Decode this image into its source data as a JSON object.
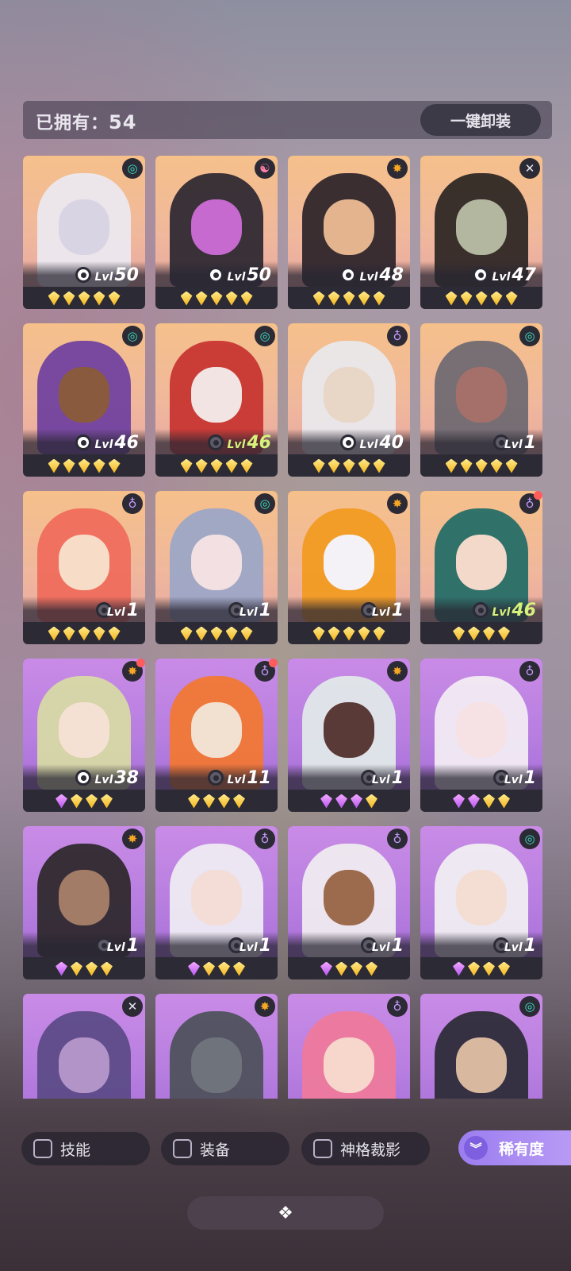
{
  "header": {
    "owned_label": "已拥有：",
    "owned_count": "54",
    "unequip_label": "一键卸装"
  },
  "level_prefix": "Lvl",
  "heroes": [
    {
      "level": "50",
      "bg": "gold",
      "faction": "teal",
      "faction_glyph": "◎",
      "gems": [
        "gold",
        "gold",
        "gold",
        "gold",
        "gold"
      ],
      "skill": true,
      "hl": false,
      "dot": false,
      "fig": "#ece9f2",
      "face": "#d9d4e4"
    },
    {
      "level": "50",
      "bg": "gold",
      "faction": "pink",
      "faction_glyph": "☯",
      "gems": [
        "gold",
        "gold",
        "gold",
        "gold",
        "gold"
      ],
      "skill": true,
      "hl": false,
      "dot": false,
      "fig": "#2a2630",
      "face": "#c66ad0"
    },
    {
      "level": "48",
      "bg": "gold",
      "faction": "orange",
      "faction_glyph": "✸",
      "gems": [
        "gold",
        "gold",
        "gold",
        "gold",
        "gold"
      ],
      "skill": true,
      "hl": false,
      "dot": false,
      "fig": "#2a2228",
      "face": "#e3b48e"
    },
    {
      "level": "47",
      "bg": "gold",
      "faction": "white",
      "faction_glyph": "✕",
      "gems": [
        "gold",
        "gold",
        "gold",
        "gold",
        "gold"
      ],
      "skill": true,
      "hl": false,
      "dot": false,
      "fig": "#2a2422",
      "face": "#b3b7a0"
    },
    {
      "level": "46",
      "bg": "gold",
      "faction": "teal",
      "faction_glyph": "◎",
      "gems": [
        "gold",
        "gold",
        "gold",
        "gold",
        "gold"
      ],
      "skill": true,
      "hl": false,
      "dot": false,
      "fig": "#6e3fa0",
      "face": "#8a5a3e"
    },
    {
      "level": "46",
      "bg": "gold",
      "faction": "teal",
      "faction_glyph": "◎",
      "gems": [
        "gold",
        "gold",
        "gold",
        "gold",
        "gold"
      ],
      "skill": false,
      "hl": true,
      "dot": false,
      "fig": "#c7322f",
      "face": "#f1e4e2"
    },
    {
      "level": "40",
      "bg": "gold",
      "faction": "violet",
      "faction_glyph": "♁",
      "gems": [
        "gold",
        "gold",
        "gold",
        "gold",
        "gold"
      ],
      "skill": true,
      "hl": false,
      "dot": false,
      "fig": "#e9e9ee",
      "face": "#e8d6c6"
    },
    {
      "level": "1",
      "bg": "gold",
      "faction": "teal",
      "faction_glyph": "◎",
      "gems": [
        "gold",
        "gold",
        "gold",
        "gold",
        "gold"
      ],
      "skill": false,
      "hl": false,
      "dot": false,
      "fig": "#6c6871",
      "face": "#a6706a"
    },
    {
      "level": "1",
      "bg": "gold",
      "faction": "violet",
      "faction_glyph": "♁",
      "gems": [
        "gold",
        "gold",
        "gold",
        "gold",
        "gold"
      ],
      "skill": false,
      "hl": false,
      "dot": false,
      "fig": "#f06a5a",
      "face": "#f7dcc8"
    },
    {
      "level": "1",
      "bg": "gold",
      "faction": "teal",
      "faction_glyph": "◎",
      "gems": [
        "gold",
        "gold",
        "gold",
        "gold",
        "gold"
      ],
      "skill": false,
      "hl": false,
      "dot": false,
      "fig": "#9aa6c8",
      "face": "#f2e0e2"
    },
    {
      "level": "1",
      "bg": "gold",
      "faction": "orange",
      "faction_glyph": "✸",
      "gems": [
        "gold",
        "gold",
        "gold",
        "gold",
        "gold"
      ],
      "skill": false,
      "hl": false,
      "dot": false,
      "fig": "#f29a1e",
      "face": "#f4f2f6"
    },
    {
      "level": "46",
      "bg": "gold",
      "faction": "violet",
      "faction_glyph": "♁",
      "gems": [
        "gold",
        "gold",
        "gold",
        "gold"
      ],
      "skill": false,
      "hl": true,
      "dot": true,
      "fig": "#1f6b66",
      "face": "#f3d9c9"
    },
    {
      "level": "38",
      "bg": "purple",
      "faction": "orange",
      "faction_glyph": "✸",
      "gems": [
        "purple",
        "gold",
        "gold",
        "gold"
      ],
      "skill": true,
      "hl": false,
      "dot": true,
      "fig": "#d8dca4",
      "face": "#f5e1d4"
    },
    {
      "level": "11",
      "bg": "purple",
      "faction": "violet",
      "faction_glyph": "♁",
      "gems": [
        "gold",
        "gold",
        "gold",
        "gold"
      ],
      "skill": false,
      "hl": false,
      "dot": true,
      "fig": "#f3772f",
      "face": "#f2e0d0"
    },
    {
      "level": "1",
      "bg": "purple",
      "faction": "orange",
      "faction_glyph": "✸",
      "gems": [
        "purple",
        "purple",
        "purple",
        "gold"
      ],
      "skill": false,
      "hl": false,
      "dot": false,
      "fig": "#e2ece9",
      "face": "#5a3a36"
    },
    {
      "level": "1",
      "bg": "purple",
      "faction": "violet",
      "faction_glyph": "♁",
      "gems": [
        "purple",
        "purple",
        "gold",
        "gold"
      ],
      "skill": false,
      "hl": false,
      "dot": false,
      "fig": "#f4eff4",
      "face": "#f6e2e4"
    },
    {
      "level": "1",
      "bg": "purple",
      "faction": "orange",
      "faction_glyph": "✸",
      "gems": [
        "purple",
        "gold",
        "gold",
        "gold"
      ],
      "skill": false,
      "hl": false,
      "dot": false,
      "fig": "#2b2729",
      "face": "#a27c66"
    },
    {
      "level": "1",
      "bg": "purple",
      "faction": "violet",
      "faction_glyph": "♁",
      "gems": [
        "purple",
        "gold",
        "gold",
        "gold"
      ],
      "skill": false,
      "hl": false,
      "dot": false,
      "fig": "#f0eef3",
      "face": "#f3ddd6"
    },
    {
      "level": "1",
      "bg": "purple",
      "faction": "violet",
      "faction_glyph": "♁",
      "gems": [
        "purple",
        "gold",
        "gold",
        "gold"
      ],
      "skill": false,
      "hl": false,
      "dot": false,
      "fig": "#f1eef0",
      "face": "#9c6a4c"
    },
    {
      "level": "1",
      "bg": "purple",
      "faction": "teal",
      "faction_glyph": "◎",
      "gems": [
        "purple",
        "gold",
        "gold",
        "gold"
      ],
      "skill": false,
      "hl": false,
      "dot": false,
      "fig": "#f2f1f3",
      "face": "#f4ddd2"
    },
    {
      "level": "",
      "bg": "purple",
      "faction": "white",
      "faction_glyph": "✕",
      "gems": [],
      "skill": false,
      "hl": false,
      "dot": false,
      "fig": "#5a4a86",
      "face": "#b394c8"
    },
    {
      "level": "",
      "bg": "purple",
      "faction": "orange",
      "faction_glyph": "✸",
      "gems": [],
      "skill": false,
      "hl": false,
      "dot": false,
      "fig": "#4c5059",
      "face": "#6e737c"
    },
    {
      "level": "",
      "bg": "purple",
      "faction": "violet",
      "faction_glyph": "♁",
      "gems": [],
      "skill": false,
      "hl": false,
      "dot": false,
      "fig": "#f07a9a",
      "face": "#f7d6cc"
    },
    {
      "level": "",
      "bg": "purple",
      "faction": "teal",
      "faction_glyph": "◎",
      "gems": [],
      "skill": false,
      "hl": false,
      "dot": false,
      "fig": "#2a2a34",
      "face": "#d8b9a0"
    }
  ],
  "filters": {
    "skill_label": "技能",
    "equip_label": "装备",
    "divine_label": "神格裁影",
    "rarity_label": "稀有度",
    "rarity_icon": "chevrons-down-icon"
  },
  "bottom": {
    "icon": "diamond-cluster-icon",
    "glyph": "❖"
  }
}
